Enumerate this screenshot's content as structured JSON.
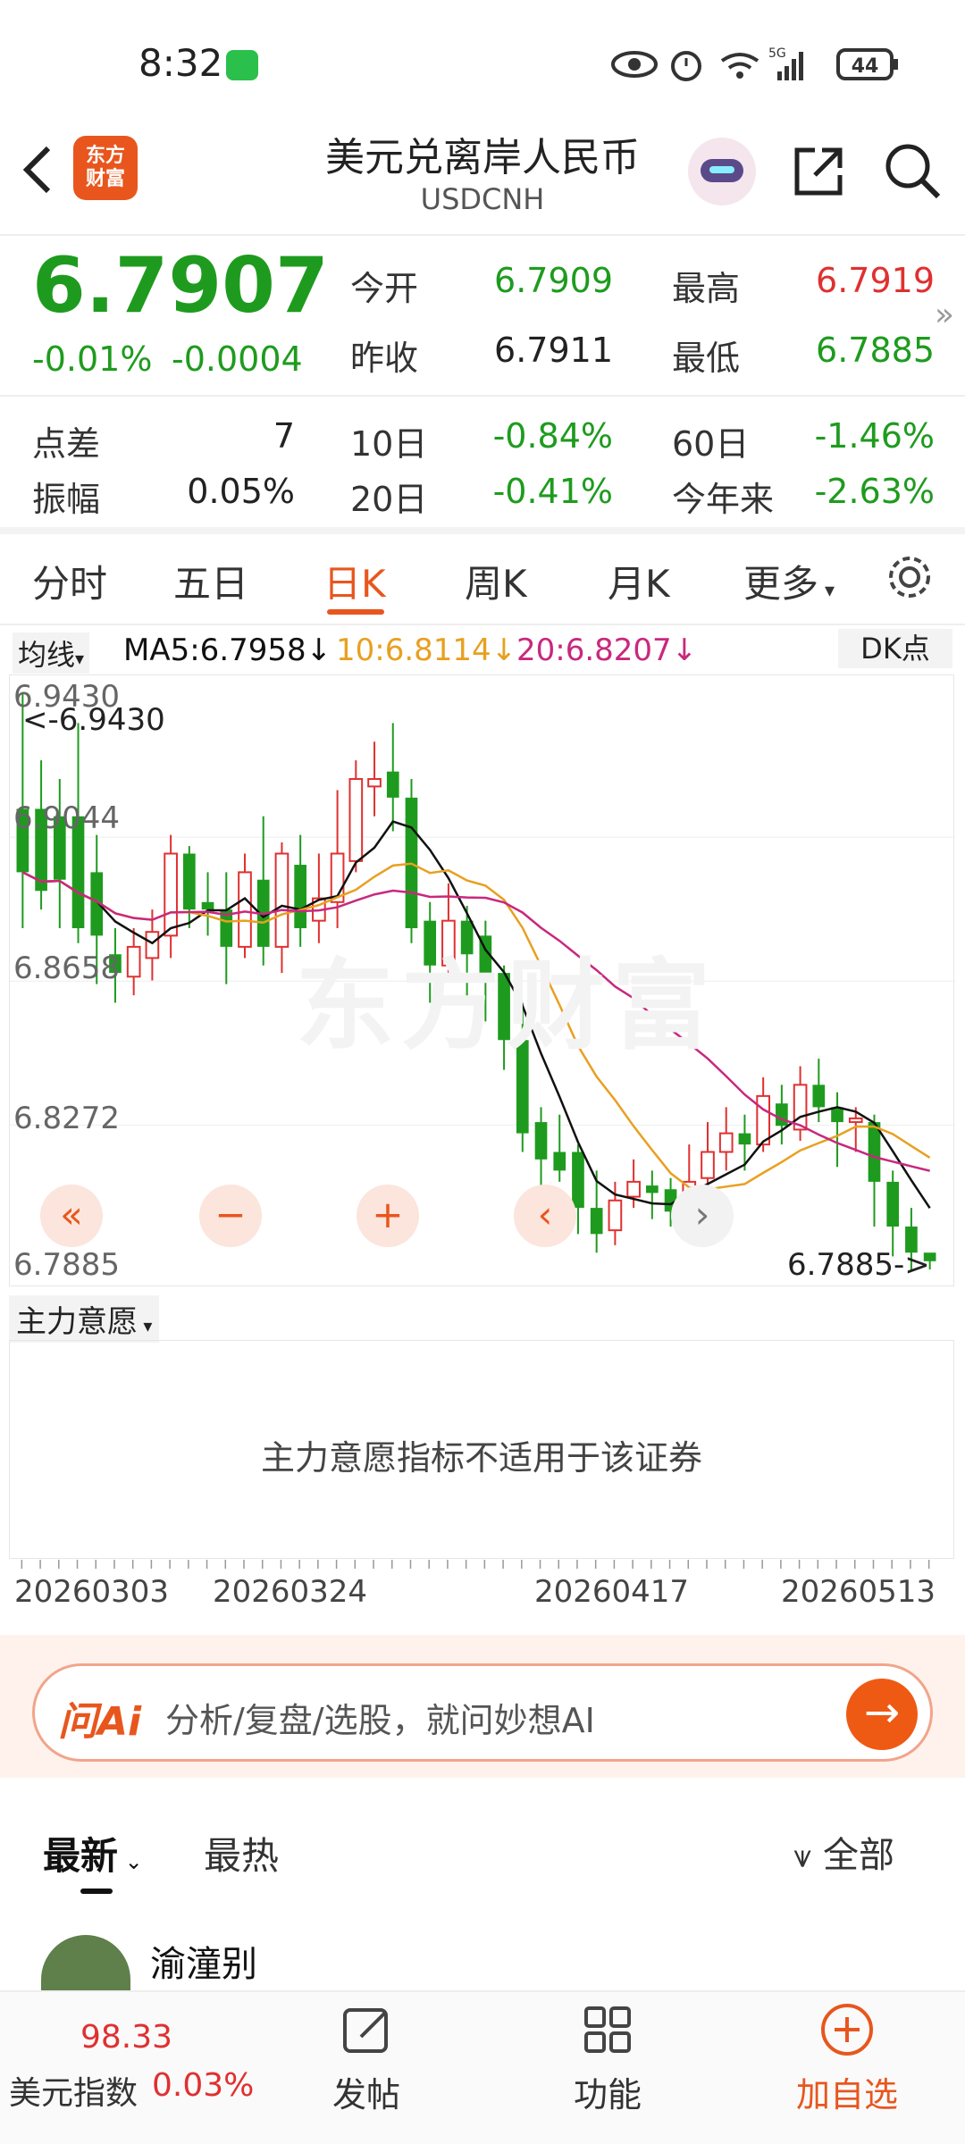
{
  "status": {
    "time": "8:32",
    "battery": "44",
    "network": "5G"
  },
  "header": {
    "logo_text": "东方财富",
    "title": "美元兑离岸人民币",
    "subtitle": "USDCNH"
  },
  "quote": {
    "price": "6.7907",
    "change_pct": "-0.01%",
    "change_abs": "-0.0004",
    "open_label": "今开",
    "open": "6.7909",
    "high_label": "最高",
    "high": "6.7919",
    "prev_close_label": "昨收",
    "prev_close": "6.7911",
    "low_label": "最低",
    "low": "6.7885",
    "spread_label": "点差",
    "spread": "7",
    "d10_label": "10日",
    "d10": "-0.84%",
    "d60_label": "60日",
    "d60": "-1.46%",
    "amp_label": "振幅",
    "amp": "0.05%",
    "d20_label": "20日",
    "d20": "-0.41%",
    "ytd_label": "今年来",
    "ytd": "-2.63%"
  },
  "tabs": [
    "分时",
    "五日",
    "日K",
    "周K",
    "月K",
    "更多"
  ],
  "ma": {
    "selector": "均线",
    "ma5": "MA5:6.7958",
    "ma10": "10:6.8114",
    "ma20": "20:6.8207",
    "dk": "DK点"
  },
  "chart_data": {
    "type": "candlestick",
    "ylim": [
      6.7885,
      6.943
    ],
    "yticks": [
      "6.9430",
      "6.9044",
      "6.8658",
      "6.8272",
      "6.7885"
    ],
    "max_label": "<-6.9430",
    "min_label": "6.7885->",
    "xticks": [
      "20260303",
      "20260324",
      "20260417",
      "20260513"
    ],
    "watermark": "东方财富",
    "candles": [
      [
        6.912,
        6.895,
        6.943,
        6.88
      ],
      [
        6.912,
        6.89,
        6.925,
        6.885
      ],
      [
        6.91,
        6.893,
        6.92,
        6.88
      ],
      [
        6.91,
        6.88,
        6.935,
        6.876
      ],
      [
        6.895,
        6.878,
        6.905,
        6.865
      ],
      [
        6.873,
        6.868,
        6.88,
        6.86
      ],
      [
        6.867,
        6.875,
        6.88,
        6.862
      ],
      [
        6.872,
        6.879,
        6.885,
        6.866
      ],
      [
        6.878,
        6.9,
        6.905,
        6.872
      ],
      [
        6.9,
        6.885,
        6.902,
        6.88
      ],
      [
        6.887,
        6.885,
        6.895,
        6.878
      ],
      [
        6.885,
        6.875,
        6.895,
        6.865
      ],
      [
        6.875,
        6.895,
        6.9,
        6.872
      ],
      [
        6.893,
        6.875,
        6.91,
        6.87
      ],
      [
        6.875,
        6.9,
        6.903,
        6.868
      ],
      [
        6.897,
        6.88,
        6.905,
        6.875
      ],
      [
        6.882,
        6.888,
        6.9,
        6.876
      ],
      [
        6.887,
        6.9,
        6.917,
        6.88
      ],
      [
        6.898,
        6.92,
        6.925,
        6.895
      ],
      [
        6.918,
        6.92,
        6.93,
        6.91
      ],
      [
        6.922,
        6.915,
        6.935,
        6.906
      ],
      [
        6.915,
        6.88,
        6.92,
        6.876
      ],
      [
        6.882,
        6.87,
        6.887,
        6.86
      ],
      [
        6.87,
        6.882,
        6.892,
        6.866
      ],
      [
        6.882,
        6.873,
        6.886,
        6.86
      ],
      [
        6.878,
        6.866,
        6.882,
        6.855
      ],
      [
        6.868,
        6.85,
        6.87,
        6.842
      ],
      [
        6.85,
        6.825,
        6.86,
        6.82
      ],
      [
        6.828,
        6.818,
        6.832,
        6.808
      ],
      [
        6.82,
        6.815,
        6.83,
        6.812
      ],
      [
        6.82,
        6.805,
        6.822,
        6.798
      ],
      [
        6.805,
        6.798,
        6.815,
        6.793
      ],
      [
        6.799,
        6.807,
        6.812,
        6.795
      ],
      [
        6.808,
        6.812,
        6.818,
        6.805
      ],
      [
        6.811,
        6.809,
        6.815,
        6.802
      ],
      [
        6.81,
        6.804,
        6.813,
        6.8
      ],
      [
        6.805,
        6.812,
        6.822,
        6.8
      ],
      [
        6.813,
        6.82,
        6.828,
        6.81
      ],
      [
        6.82,
        6.825,
        6.832,
        6.815
      ],
      [
        6.825,
        6.822,
        6.83,
        6.815
      ],
      [
        6.822,
        6.835,
        6.84,
        6.82
      ],
      [
        6.833,
        6.827,
        6.838,
        6.822
      ],
      [
        6.826,
        6.838,
        6.843,
        6.823
      ],
      [
        6.838,
        6.832,
        6.845,
        6.828
      ],
      [
        6.832,
        6.828,
        6.836,
        6.816
      ],
      [
        6.828,
        6.829,
        6.832,
        6.82
      ],
      [
        6.828,
        6.812,
        6.83,
        6.8
      ],
      [
        6.812,
        6.8,
        6.815,
        6.792
      ],
      [
        6.8,
        6.793,
        6.805,
        6.788
      ],
      [
        6.793,
        6.7907,
        6.7919,
        6.7885
      ]
    ]
  },
  "indicator": {
    "selector": "主力意愿",
    "message": "主力意愿指标不适用于该证券"
  },
  "ai": {
    "badge": "问Ai",
    "placeholder": "分析/复盘/选股，就问妙想AI"
  },
  "feed": {
    "tab_latest": "最新",
    "tab_hot": "最热",
    "filter": "全部",
    "first_user": "渝潼别"
  },
  "bottom_nav": {
    "index_value": "98.33",
    "index_name": "美元指数",
    "index_change": "0.03%",
    "post": "发帖",
    "func": "功能",
    "watch": "加自选"
  },
  "colors": {
    "up": "#e03030",
    "down": "#1e9b1e",
    "accent": "#e8561e",
    "ma5": "#111111",
    "ma10": "#e8a020",
    "ma20": "#c8287e"
  }
}
